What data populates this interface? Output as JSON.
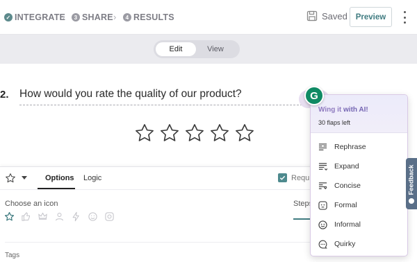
{
  "header": {
    "steps": [
      {
        "number": "✓",
        "label": "INTEGRATE"
      },
      {
        "number": "3",
        "label": "SHARE"
      },
      {
        "number": "4",
        "label": "RESULTS"
      }
    ],
    "saved_label": "Saved",
    "preview_label": "Preview"
  },
  "mode_toggle": {
    "edit_label": "Edit",
    "view_label": "View",
    "active": "Edit"
  },
  "question": {
    "number": "2.",
    "text": "How would you rate the quality of our product?",
    "rating_stars": 5
  },
  "settings_panel": {
    "tabs": {
      "options": "Options",
      "logic": "Logic"
    },
    "required_label": "Requi",
    "choose_icon_label": "Choose an icon",
    "icon_options": [
      "star-icon",
      "thumbs-up-icon",
      "crown-icon",
      "user-icon",
      "lightning-icon",
      "smiley-icon",
      "instagram-icon"
    ],
    "steps_label": "Steps",
    "tags_label": "Tags"
  },
  "grammarly": {
    "badge": "G",
    "headline_start": "Wing it ",
    "headline_end": "with AI!",
    "flaps_left": "30 flaps left",
    "items": [
      "Rephrase",
      "Expand",
      "Concise",
      "Formal",
      "Informal",
      "Quirky"
    ]
  },
  "feedback_tab": "Feedback",
  "colors": {
    "accent": "#3f7b80",
    "grammarly_green": "#0f8a64",
    "grammarly_purple": "#7566b3",
    "feedback_tab": "#5a6f88"
  }
}
